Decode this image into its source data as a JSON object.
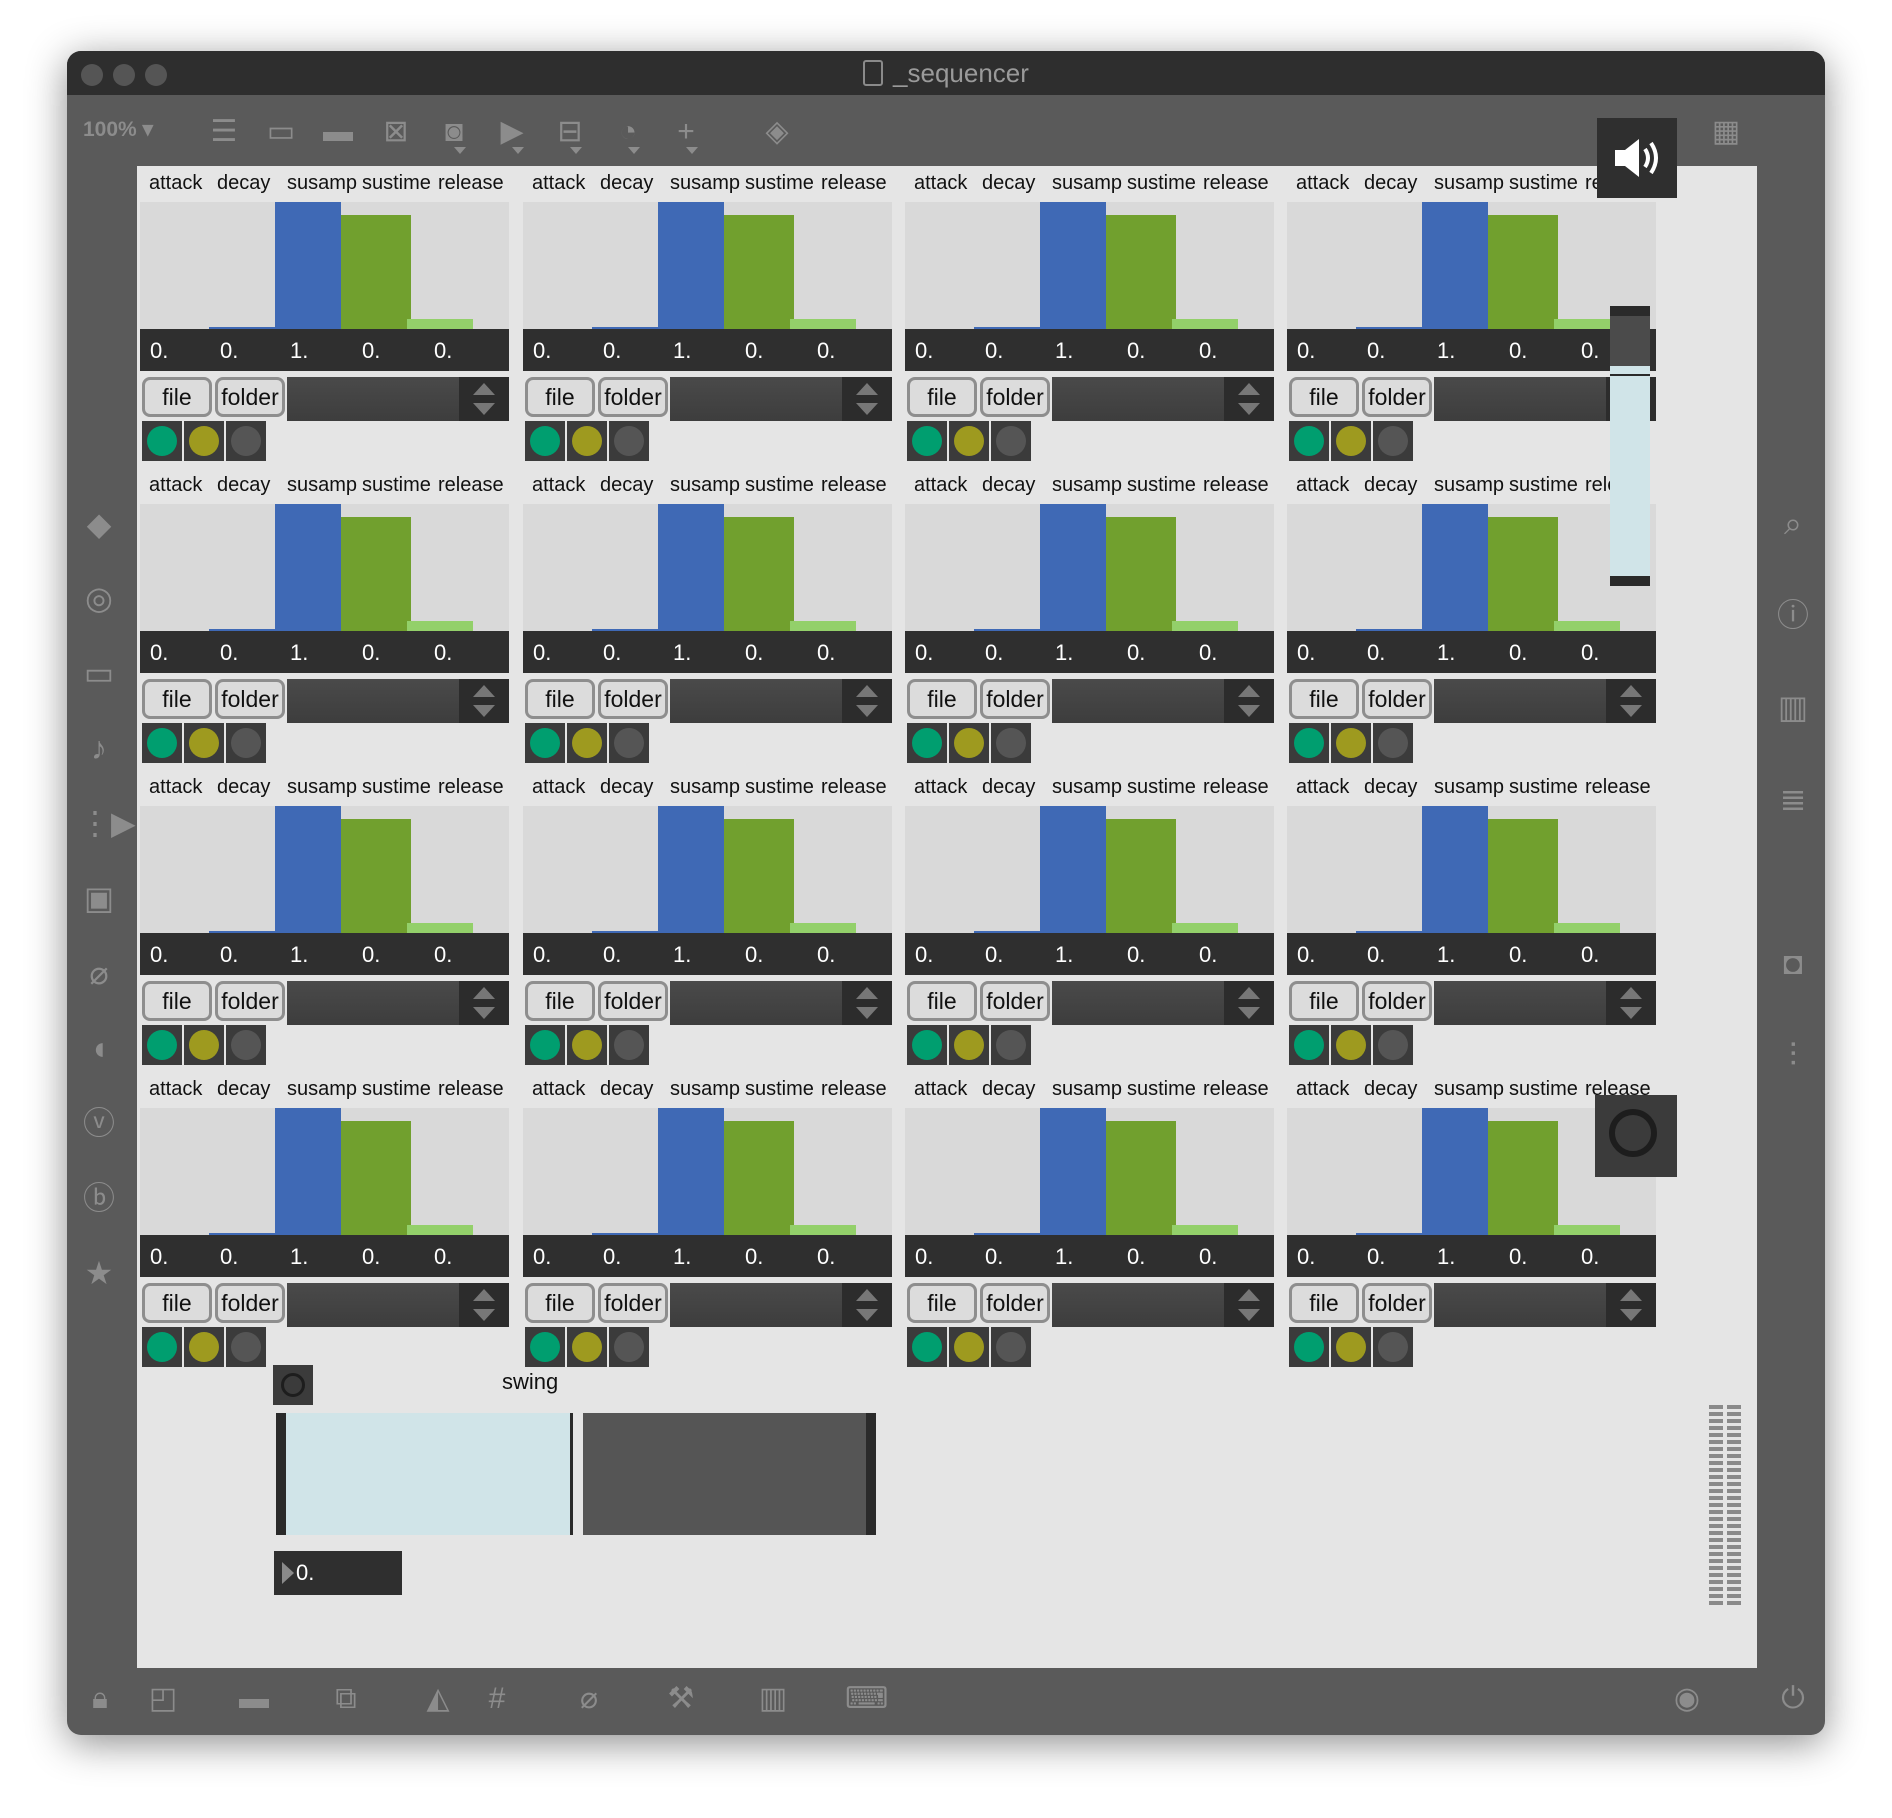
{
  "window": {
    "title": "_sequencer"
  },
  "toolbar": {
    "zoom": "100%"
  },
  "module": {
    "labels": [
      "attack",
      "decay",
      "susamp",
      "sustime",
      "release"
    ],
    "values": [
      "0.",
      "0.",
      "1.",
      "0.",
      "0."
    ],
    "slider_levels": [
      0,
      0.01,
      1,
      0.9,
      0.08
    ],
    "slider_colors": [
      "#3f69b5",
      "#3f69b5",
      "#3f69b5",
      "#71a02e",
      "#93d06a"
    ],
    "file_label": "file",
    "folder_label": "folder",
    "led_colors": [
      "#009e6f",
      "#9e9a1f",
      "#555555"
    ]
  },
  "modules_grid": {
    "rows": 4,
    "cols": 4
  },
  "swing": {
    "label": "swing",
    "value": "0.",
    "level": 0.49
  },
  "colors": {
    "window_bg": "#5a5a5a",
    "canvas_bg": "#e5e5e5",
    "titlebar": "#2e2e2e"
  }
}
